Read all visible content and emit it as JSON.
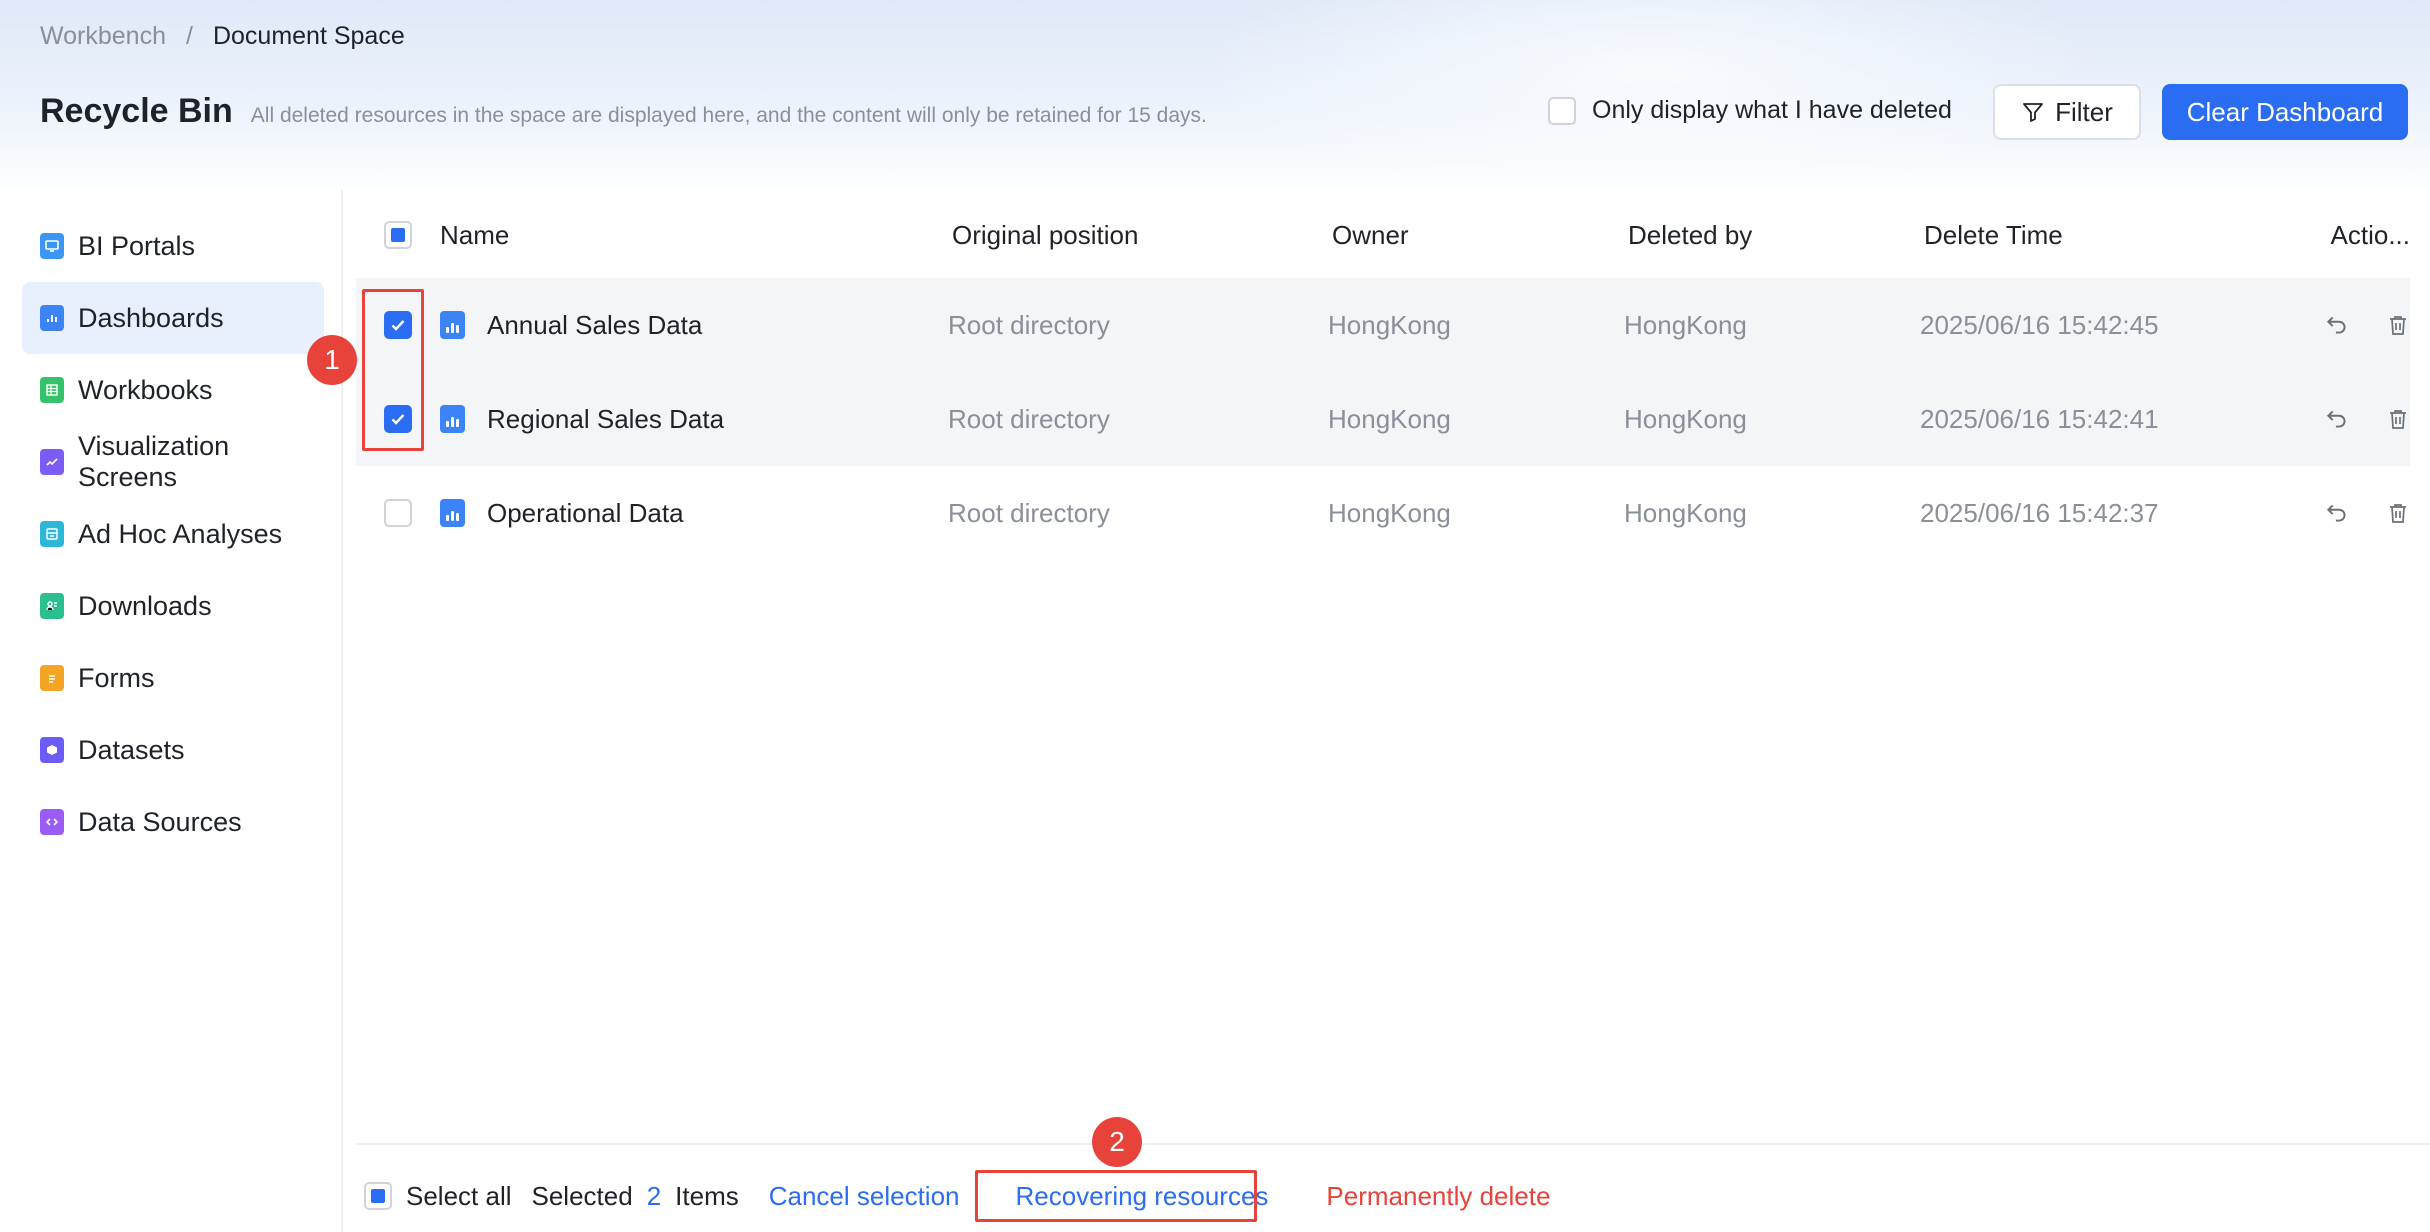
{
  "breadcrumb": {
    "root": "Workbench",
    "separator": "/",
    "current": "Document Space"
  },
  "page": {
    "title": "Recycle Bin",
    "description": "All deleted resources in the space are displayed here, and the content will only be retained for 15 days."
  },
  "toolbar": {
    "only_mine_label": "Only display what I have deleted",
    "filter_label": "Filter",
    "clear_label": "Clear Dashboard"
  },
  "sidebar": {
    "items": [
      {
        "label": "BI Portals",
        "icon": "monitor-icon",
        "color": "#3c96f6",
        "active": false
      },
      {
        "label": "Dashboards",
        "icon": "bar-chart-icon",
        "color": "#3c84f6",
        "active": true
      },
      {
        "label": "Workbooks",
        "icon": "table-icon",
        "color": "#34c26a",
        "active": false
      },
      {
        "label": "Visualization Screens",
        "icon": "screen-chart-icon",
        "color": "#7b5cf5",
        "active": false
      },
      {
        "label": "Ad Hoc Analyses",
        "icon": "analysis-icon",
        "color": "#2cb7d6",
        "active": false
      },
      {
        "label": "Downloads",
        "icon": "download-icon",
        "color": "#2bbf8f",
        "active": false
      },
      {
        "label": "Forms",
        "icon": "form-icon",
        "color": "#f5a524",
        "active": false
      },
      {
        "label": "Datasets",
        "icon": "cube-icon",
        "color": "#6b5cf5",
        "active": false
      },
      {
        "label": "Data Sources",
        "icon": "code-icon",
        "color": "#9a5cf5",
        "active": false
      }
    ]
  },
  "table": {
    "headers": {
      "name": "Name",
      "position": "Original position",
      "owner": "Owner",
      "deleted_by": "Deleted by",
      "delete_time": "Delete Time",
      "actions": "Actio..."
    },
    "rows": [
      {
        "name": "Annual Sales Data",
        "position": "Root directory",
        "owner": "HongKong",
        "deleted_by": "HongKong",
        "delete_time": "2025/06/16 15:42:45",
        "checked": true
      },
      {
        "name": "Regional Sales Data",
        "position": "Root directory",
        "owner": "HongKong",
        "deleted_by": "HongKong",
        "delete_time": "2025/06/16 15:42:41",
        "checked": true
      },
      {
        "name": "Operational Data",
        "position": "Root directory",
        "owner": "HongKong",
        "deleted_by": "HongKong",
        "delete_time": "2025/06/16 15:42:37",
        "checked": false
      }
    ]
  },
  "footer": {
    "select_all": "Select all",
    "selected_prefix": "Selected",
    "selected_count": "2",
    "selected_suffix": "Items",
    "cancel": "Cancel selection",
    "recover": "Recovering resources",
    "delete": "Permanently delete"
  },
  "annotations": {
    "step1": "1",
    "step2": "2"
  },
  "colors": {
    "accent": "#2b6df2",
    "danger": "#e8433a",
    "muted": "#8a8f99"
  }
}
